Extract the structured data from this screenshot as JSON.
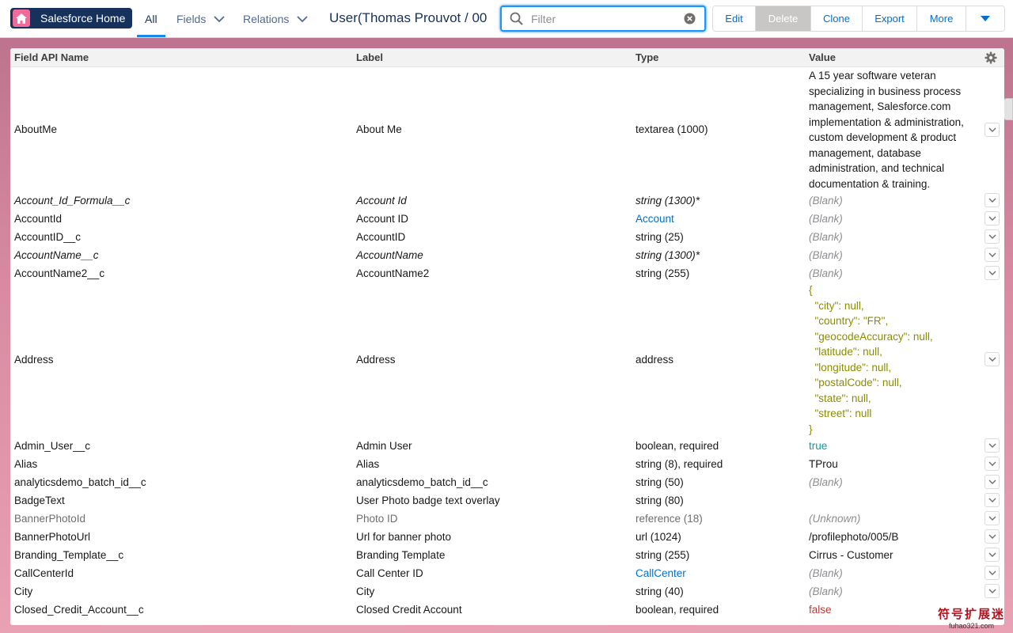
{
  "app": {
    "home_label": "Salesforce Home",
    "tabs": [
      {
        "label": "All"
      },
      {
        "label": "Fields"
      },
      {
        "label": "Relations"
      }
    ],
    "record_title": "User(Thomas Prouvot / 00",
    "filter": {
      "placeholder": "Filter",
      "value": ""
    },
    "actions": [
      {
        "label": "Edit",
        "disabled": false
      },
      {
        "label": "Delete",
        "disabled": true
      },
      {
        "label": "Clone",
        "disabled": false
      },
      {
        "label": "Export",
        "disabled": false
      },
      {
        "label": "More",
        "disabled": false
      }
    ]
  },
  "table": {
    "headers": {
      "api": "Field API Name",
      "label": "Label",
      "type": "Type",
      "value": "Value"
    },
    "rows": [
      {
        "api": "AboutMe",
        "label": "About Me",
        "type": "textarea (1000)",
        "value": "A 15 year software veteran specializing in business process management, Salesforce.com implementation & administration, custom development & product management, database administration, and technical documentation & training."
      },
      {
        "api": "Account_Id_Formula__c",
        "label": "Account Id",
        "type": "string (1300)*",
        "value": "(Blank)"
      },
      {
        "api": "AccountId",
        "label": "Account ID",
        "type": "Account",
        "value": "(Blank)"
      },
      {
        "api": "AccountID__c",
        "label": "AccountID",
        "type": "string (25)",
        "value": "(Blank)"
      },
      {
        "api": "AccountName__c",
        "label": "AccountName",
        "type": "string (1300)*",
        "value": "(Blank)"
      },
      {
        "api": "AccountName2__c",
        "label": "AccountName2",
        "type": "string (255)",
        "value": "(Blank)"
      },
      {
        "api": "Address",
        "label": "Address",
        "type": "address",
        "value": "{\n  \"city\": null,\n  \"country\": \"FR\",\n  \"geocodeAccuracy\": null,\n  \"latitude\": null,\n  \"longitude\": null,\n  \"postalCode\": null,\n  \"state\": null,\n  \"street\": null\n}"
      },
      {
        "api": "Admin_User__c",
        "label": "Admin User",
        "type": "boolean, required",
        "value": "true"
      },
      {
        "api": "Alias",
        "label": "Alias",
        "type": "string (8), required",
        "value": "TProu"
      },
      {
        "api": "analyticsdemo_batch_id__c",
        "label": "analyticsdemo_batch_id__c",
        "type": "string (50)",
        "value": "(Blank)"
      },
      {
        "api": "BadgeText",
        "label": "User Photo badge text overlay",
        "type": "string (80)",
        "value": ""
      },
      {
        "api": "BannerPhotoId",
        "label": "Photo ID",
        "type": "reference (18)",
        "value": "(Unknown)"
      },
      {
        "api": "BannerPhotoUrl",
        "label": "Url for banner photo",
        "type": "url (1024)",
        "value": "/profilephoto/005/B"
      },
      {
        "api": "Branding_Template__c",
        "label": "Branding Template",
        "type": "string (255)",
        "value": "Cirrus - Customer"
      },
      {
        "api": "CallCenterId",
        "label": "Call Center ID",
        "type": "CallCenter",
        "value": "(Blank)"
      },
      {
        "api": "City",
        "label": "City",
        "type": "string (40)",
        "value": "(Blank)"
      },
      {
        "api": "Closed_Credit_Account__c",
        "label": "Closed Credit Account",
        "type": "boolean, required",
        "value": "false"
      }
    ]
  },
  "watermark": {
    "text": "符号扩展迷",
    "url": "fuhao321.com"
  }
}
